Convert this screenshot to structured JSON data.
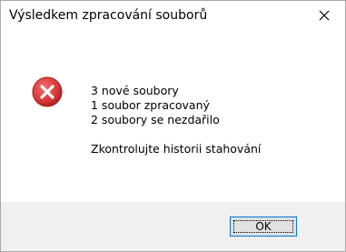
{
  "dialog": {
    "title": "Výsledkem zpracování souborů",
    "close_icon": "close-icon",
    "status_icon": "error-icon",
    "accent_color": "#0078d7",
    "error_color": "#d83b3b"
  },
  "message": {
    "lines": [
      "3 nové soubory",
      "1 soubor zpracovaný",
      "2 soubory se nezdařilo"
    ],
    "instruction": "Zkontrolujte historii stahování"
  },
  "buttons": {
    "ok_label": "OK"
  }
}
